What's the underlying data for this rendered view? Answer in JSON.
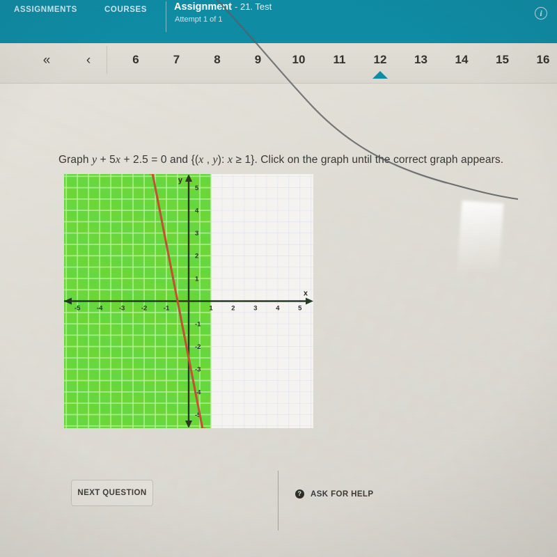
{
  "topbar": {
    "nav": [
      {
        "label": "ASSIGNMENTS"
      },
      {
        "label": "COURSES"
      }
    ],
    "assignment_label": "Assignment",
    "assignment_name": "- 21. Test",
    "attempt": "Attempt 1 of 1",
    "info_icon": "info-icon",
    "background_color": "#0e8ba4"
  },
  "pager": {
    "first_icon": "«",
    "prev_icon": "‹",
    "pages": [
      "6",
      "7",
      "8",
      "9",
      "10",
      "11",
      "12",
      "13",
      "14",
      "15",
      "16"
    ],
    "active_page": "12",
    "active_color": "#0e8ba4"
  },
  "question": {
    "prefix": "Graph ",
    "eq_y": "y",
    "eq_plus1": " + 5",
    "eq_x": "x",
    "eq_rest": " + 2.5 = 0 and {(",
    "set_x": "x",
    "set_comma": " , ",
    "set_y": "y",
    "set_tail": "): ",
    "set_x2": "x",
    "set_cond": " ≥ 1}. ",
    "suffix": "Click on the graph until the correct graph appears."
  },
  "chart_data": {
    "type": "line",
    "title": "",
    "xlabel": "x",
    "ylabel": "y",
    "xlim": [
      -5.6,
      5.6
    ],
    "ylim": [
      -5.6,
      5.6
    ],
    "xticks": [
      -5,
      -4,
      -3,
      -2,
      -1,
      1,
      2,
      3,
      4,
      5
    ],
    "yticks": [
      5,
      4,
      3,
      2,
      1,
      -1,
      -2,
      -3,
      -4,
      -5
    ],
    "grid": true,
    "grid_color": "#c9d4e8",
    "axis_color": "#14270f",
    "series": [
      {
        "name": "y = -5x - 2.5",
        "type": "line",
        "color": "#b8441f",
        "slope": -5,
        "intercept": -2.5,
        "arrow_both_ends": true,
        "points": [
          [
            -1.62,
            5.6
          ],
          [
            0.62,
            -5.6
          ]
        ]
      },
      {
        "name": "shaded region x < 1",
        "type": "region",
        "color": "#4fd21a",
        "x_from": -5.6,
        "x_to": 1.0
      }
    ]
  },
  "footer": {
    "next_label": "NEXT QUESTION",
    "help_icon": "question-mark-icon",
    "help_label": "ASK FOR HELP"
  }
}
